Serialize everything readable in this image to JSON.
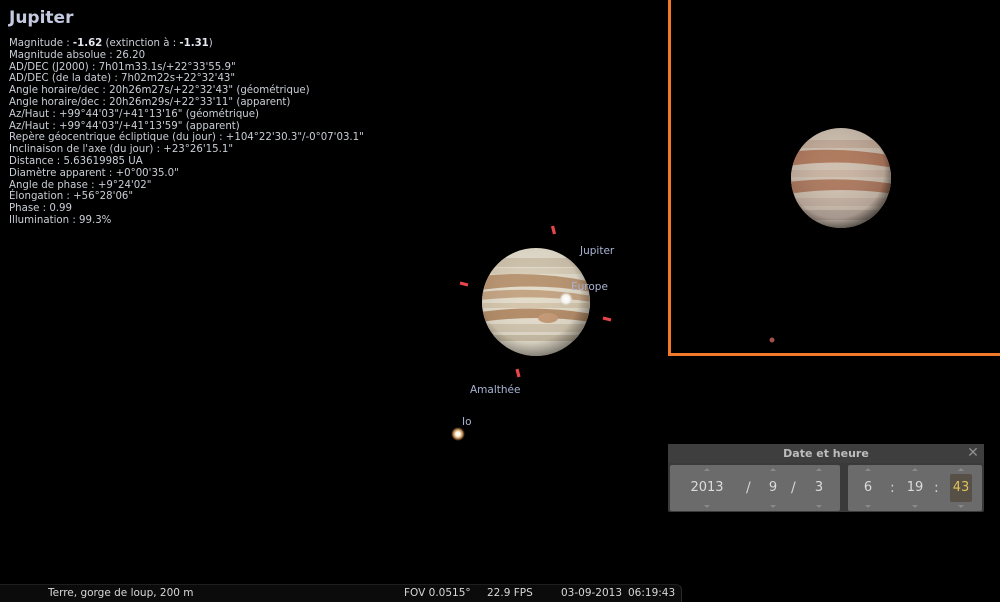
{
  "object": {
    "name": "Jupiter",
    "info_lines": [
      {
        "prefix": "Magnitude : ",
        "bold": "-1.62",
        "mid": " (extinction à : ",
        "bold2": "-1.31",
        "suffix": ")"
      },
      {
        "text": "Magnitude absolue : 26.20"
      },
      {
        "text": "AD/DEC (J2000) : 7h01m33.1s/+22°33'55.9\""
      },
      {
        "text": "AD/DEC (de la date) : 7h02m22s+22°32'43\""
      },
      {
        "text": "Angle horaire/dec : 20h26m27s/+22°32'43\" (géométrique)"
      },
      {
        "text": "Angle horaire/dec : 20h26m29s/+22°33'11\" (apparent)"
      },
      {
        "text": "Az/Haut : +99°44'03\"/+41°13'16\" (géométrique)"
      },
      {
        "text": "Az/Haut : +99°44'03\"/+41°13'59\" (apparent)"
      },
      {
        "text": "Repère géocentrique écliptique (du jour) : +104°22'30.3\"/-0°07'03.1\""
      },
      {
        "text": "Inclinaison de l'axe (du jour) : +23°26'15.1\""
      },
      {
        "text": "Distance : 5.63619985 UA"
      },
      {
        "text": "Diamètre apparent : +0°00'35.0\""
      },
      {
        "text": "Angle de phase : +9°24'02\""
      },
      {
        "text": "Élongation : +56°28'06\""
      },
      {
        "text": "Phase : 0.99"
      },
      {
        "text": "Illumination : 99.3%"
      }
    ]
  },
  "sky_labels": {
    "jupiter": "Jupiter",
    "europa": "Europe",
    "amalthea": "Amalthée",
    "io": "Io"
  },
  "colors": {
    "ocular_border": "#f07a2a",
    "selection_marker": "#e8454a",
    "time_highlight": "#e0c15a"
  },
  "date_time_dialog": {
    "title": "Date et heure",
    "close_icon": "close-icon",
    "year": "2013",
    "month": "9",
    "day": "3",
    "hour": "6",
    "minute": "19",
    "second": "43",
    "date_sep": "/",
    "time_sep": ":"
  },
  "status_bar": {
    "location": "Terre, gorge de loup, 200 m",
    "fov": "FOV 0.0515°",
    "fps": "22.9 FPS",
    "date": "03-09-2013",
    "time": "06:19:43"
  }
}
